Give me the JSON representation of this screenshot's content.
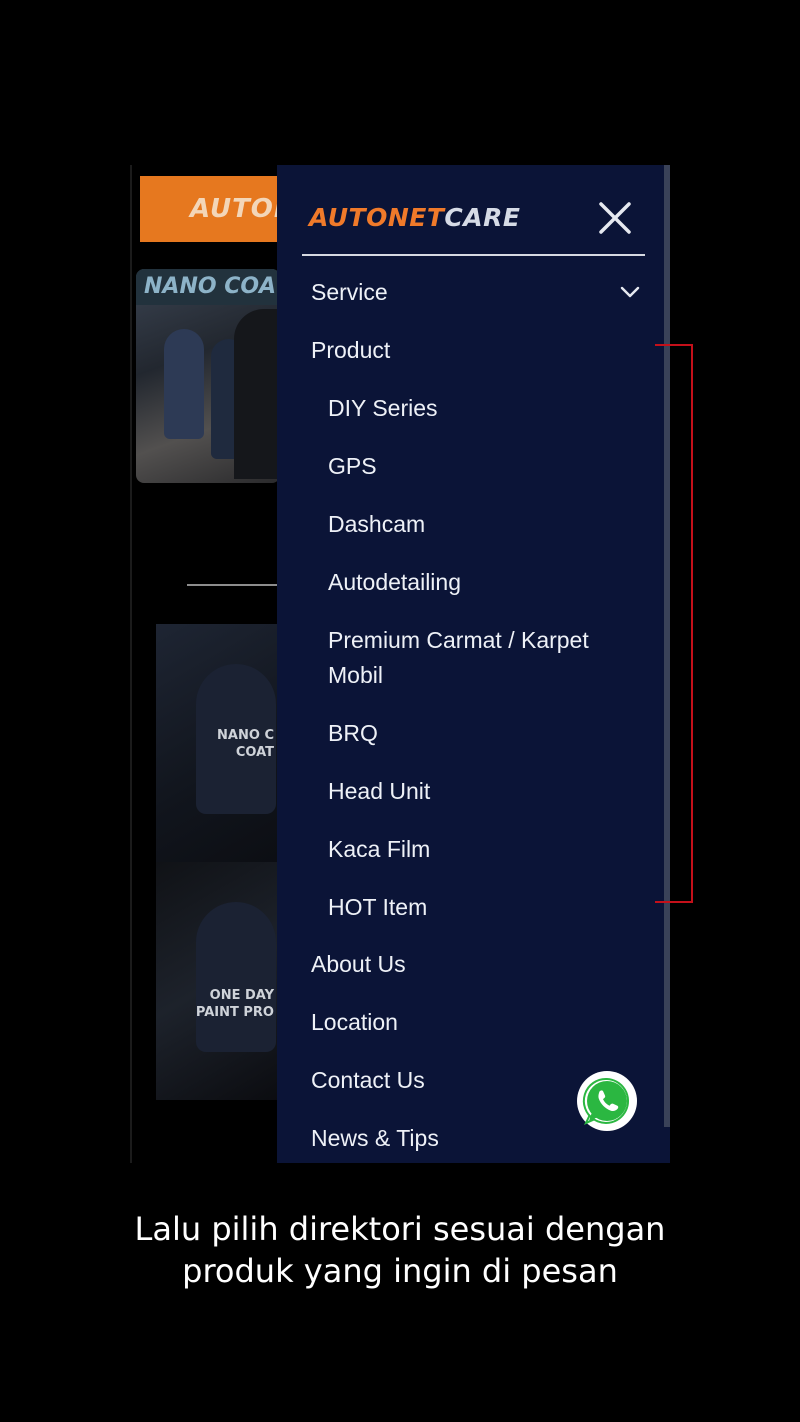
{
  "background_page": {
    "header_logo_fragment": "AUTON",
    "banner_label": "NANO COA",
    "card1_caption": "NANO C\nCOAT",
    "card2_caption": "ONE DAY\nPAINT PRO"
  },
  "drawer": {
    "brand_part1": "AUTONET",
    "brand_part2": "CARE",
    "close_icon": "close-icon",
    "menu": {
      "service": "Service",
      "product": "Product",
      "sub_items": [
        "DIY Series",
        "GPS",
        "Dashcam",
        "Autodetailing",
        "Premium Carmat / Karpet Mobil",
        "BRQ",
        "Head Unit",
        "Kaca Film",
        "HOT Item"
      ],
      "about": "About Us",
      "location": "Location",
      "contact": "Contact Us",
      "news": "News & Tips"
    },
    "chevron_icon": "chevron-down-icon"
  },
  "whatsapp_icon": "whatsapp-icon",
  "caption": {
    "line1": "Lalu pilih direktori sesuai dengan",
    "line2": "produk yang ingin di pesan"
  },
  "colors": {
    "drawer_bg": "#0b1437",
    "brand_orange": "#f07a2a",
    "annotation_red": "#c4101a",
    "whatsapp_green": "#2bb741"
  }
}
